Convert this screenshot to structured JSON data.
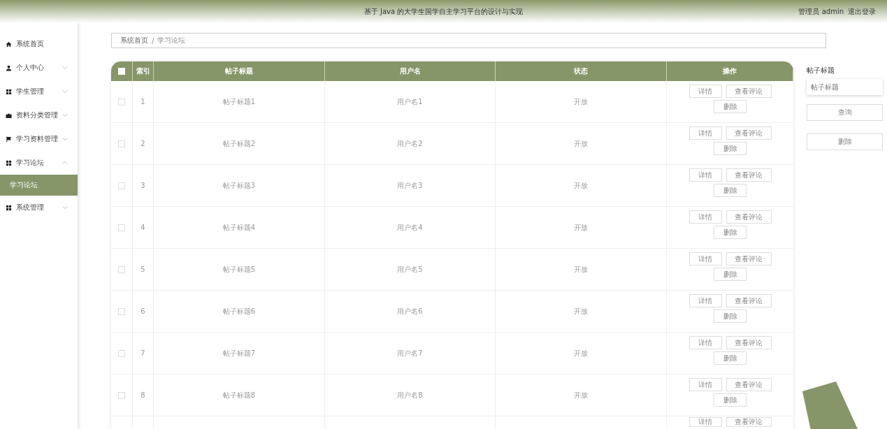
{
  "header": {
    "title": "基于 Java 的大学生国学自主学习平台的设计与实现",
    "user": "管理员 admin",
    "logout": "退出登录"
  },
  "sidebar": {
    "items": [
      {
        "label": "系统首页"
      },
      {
        "label": "个人中心",
        "expanded": false
      },
      {
        "label": "学生管理",
        "expanded": false
      },
      {
        "label": "资料分类管理",
        "expanded": false
      },
      {
        "label": "学习资料管理",
        "expanded": false
      },
      {
        "label": "学习论坛",
        "expanded": true,
        "children": [
          {
            "label": "学习论坛",
            "selected": true
          }
        ]
      },
      {
        "label": "系统管理",
        "expanded": false
      }
    ]
  },
  "breadcrumb": [
    "系统首页",
    "/",
    "学习论坛"
  ],
  "table": {
    "header_checkbox": {
      "checked": false
    },
    "columns": [
      "索引",
      "帖子标题",
      "用户名",
      "状态",
      "操作"
    ],
    "rows": [
      {
        "checked": false,
        "index": "1",
        "title": "帖子标题1",
        "user": "用户名1",
        "status": "开放",
        "actions": [
          "详情",
          "查看评论",
          "删除"
        ]
      },
      {
        "checked": false,
        "index": "2",
        "title": "帖子标题2",
        "user": "用户名2",
        "status": "开放",
        "actions": [
          "详情",
          "查看评论",
          "删除"
        ]
      },
      {
        "checked": false,
        "index": "3",
        "title": "帖子标题3",
        "user": "用户名3",
        "status": "开放",
        "actions": [
          "详情",
          "查看评论",
          "删除"
        ]
      },
      {
        "checked": false,
        "index": "4",
        "title": "帖子标题4",
        "user": "用户名4",
        "status": "开放",
        "actions": [
          "详情",
          "查看评论",
          "删除"
        ]
      },
      {
        "checked": false,
        "index": "5",
        "title": "帖子标题5",
        "user": "用户名5",
        "status": "开放",
        "actions": [
          "详情",
          "查看评论",
          "删除"
        ]
      },
      {
        "checked": false,
        "index": "6",
        "title": "帖子标题6",
        "user": "用户名6",
        "status": "开放",
        "actions": [
          "详情",
          "查看评论",
          "删除"
        ]
      },
      {
        "checked": false,
        "index": "7",
        "title": "帖子标题7",
        "user": "用户名7",
        "status": "开放",
        "actions": [
          "详情",
          "查看评论",
          "删除"
        ]
      },
      {
        "checked": false,
        "index": "8",
        "title": "帖子标题8",
        "user": "用户名8",
        "status": "开放",
        "actions": [
          "详情",
          "查看评论",
          "删除"
        ]
      },
      {
        "actions": [
          "详情",
          "查看评论"
        ]
      }
    ]
  },
  "search": {
    "label": "帖子标题",
    "placeholder": "帖子标题",
    "buttons": [
      "查询",
      "删除"
    ]
  }
}
